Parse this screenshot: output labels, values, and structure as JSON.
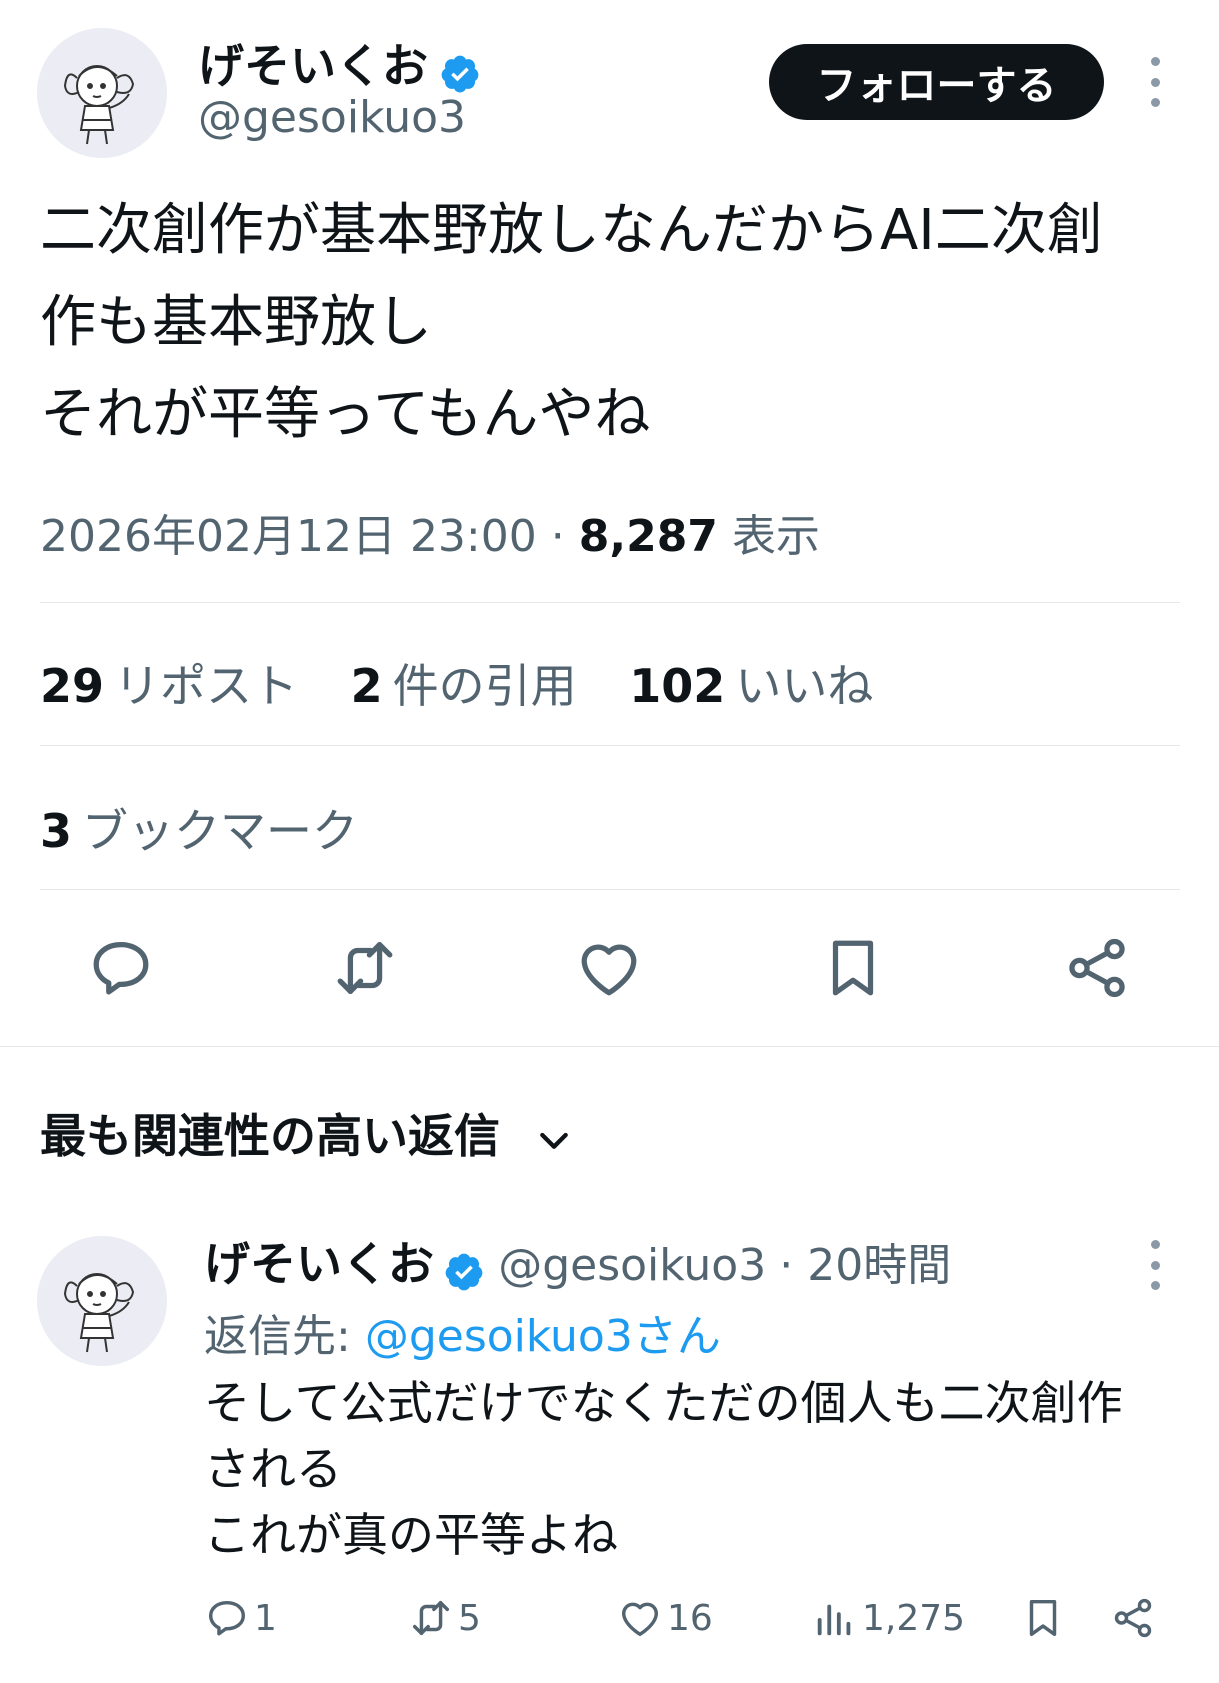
{
  "tweet": {
    "author": {
      "name": "げそいくお",
      "handle": "@gesoikuo3",
      "verified": true,
      "avatar_icon": "anime-character-avatar"
    },
    "follow_label": "フォローする",
    "text_lines": [
      "二次創作が基本野放しなんだからAI二次創",
      "作も基本野放し",
      "それが平等ってもんやね"
    ],
    "timestamp": "2026年02月12日 23:00",
    "separator": "·",
    "views_count": "8,287",
    "views_label": "表示",
    "stats": {
      "reposts_count": "29",
      "reposts_label": "リポスト",
      "quotes_count": "2",
      "quotes_label": "件の引用",
      "likes_count": "102",
      "likes_label": "いいね",
      "bookmarks_count": "3",
      "bookmarks_label": "ブックマーク"
    },
    "actions": [
      "reply-icon",
      "repost-icon",
      "like-icon",
      "bookmark-icon",
      "share-icon"
    ]
  },
  "replies": {
    "sort_label": "最も関連性の高い返信",
    "items": [
      {
        "name": "げそいくお",
        "handle": "@gesoikuo3",
        "time": "· 20時間",
        "reply_to_label": "返信先:",
        "reply_to_handle": "@gesoikuo3さん",
        "text_lines": [
          "そして公式だけでなくただの個人も二次創作",
          "される",
          "これが真の平等よね"
        ],
        "reply_count": "1",
        "repost_count": "5",
        "like_count": "16",
        "view_count": "1,275"
      }
    ]
  },
  "colors": {
    "text": "#0f1419",
    "secondary": "#536471",
    "accent": "#1d9bf0",
    "verified": "#1d9bf0",
    "divider": "#e6e9ec"
  }
}
